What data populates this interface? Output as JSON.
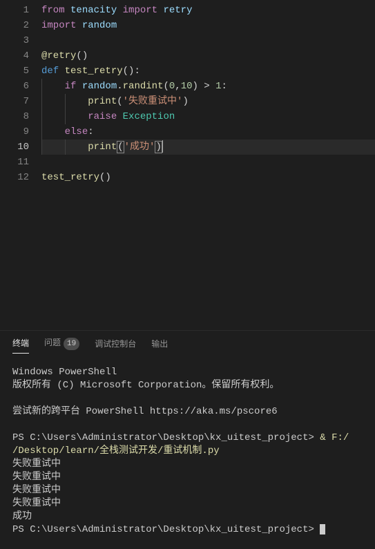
{
  "editor": {
    "current_line": 10,
    "lines": [
      {
        "n": 1,
        "tokens": [
          {
            "t": "from",
            "c": "keyword"
          },
          {
            "t": " "
          },
          {
            "t": "tenacity",
            "c": "ident"
          },
          {
            "t": " "
          },
          {
            "t": "import",
            "c": "keyword"
          },
          {
            "t": " "
          },
          {
            "t": "retry",
            "c": "ident"
          }
        ]
      },
      {
        "n": 2,
        "tokens": [
          {
            "t": "import",
            "c": "keyword"
          },
          {
            "t": " "
          },
          {
            "t": "random",
            "c": "ident"
          }
        ]
      },
      {
        "n": 3,
        "tokens": []
      },
      {
        "n": 4,
        "tokens": [
          {
            "t": "@retry",
            "c": "deco"
          },
          {
            "t": "()",
            "c": "punc"
          }
        ]
      },
      {
        "n": 5,
        "tokens": [
          {
            "t": "def",
            "c": "builtin"
          },
          {
            "t": " "
          },
          {
            "t": "test_retry",
            "c": "func"
          },
          {
            "t": "():",
            "c": "punc"
          }
        ]
      },
      {
        "n": 6,
        "indent": 1,
        "tokens": [
          {
            "t": "    "
          },
          {
            "t": "if",
            "c": "keyword"
          },
          {
            "t": " "
          },
          {
            "t": "random",
            "c": "ident"
          },
          {
            "t": ".",
            "c": "punc"
          },
          {
            "t": "randint",
            "c": "func"
          },
          {
            "t": "(",
            "c": "punc"
          },
          {
            "t": "0",
            "c": "num"
          },
          {
            "t": ",",
            "c": "punc"
          },
          {
            "t": "10",
            "c": "num"
          },
          {
            "t": ") > ",
            "c": "op"
          },
          {
            "t": "1",
            "c": "num"
          },
          {
            "t": ":",
            "c": "punc"
          }
        ]
      },
      {
        "n": 7,
        "indent": 2,
        "tokens": [
          {
            "t": "        "
          },
          {
            "t": "print",
            "c": "func"
          },
          {
            "t": "(",
            "c": "punc"
          },
          {
            "t": "'失败重试中'",
            "c": "string"
          },
          {
            "t": ")",
            "c": "punc"
          }
        ]
      },
      {
        "n": 8,
        "indent": 2,
        "tokens": [
          {
            "t": "        "
          },
          {
            "t": "raise",
            "c": "keyword"
          },
          {
            "t": " "
          },
          {
            "t": "Exception",
            "c": "type"
          }
        ]
      },
      {
        "n": 9,
        "indent": 1,
        "tokens": [
          {
            "t": "    "
          },
          {
            "t": "else",
            "c": "keyword"
          },
          {
            "t": ":",
            "c": "punc"
          }
        ]
      },
      {
        "n": 10,
        "indent": 2,
        "current": true,
        "tokens": [
          {
            "t": "        "
          },
          {
            "t": "print",
            "c": "func"
          },
          {
            "t": "(",
            "c": "punc",
            "box": true
          },
          {
            "t": "'成功'",
            "c": "string"
          },
          {
            "t": ")",
            "c": "punc",
            "box": true
          }
        ]
      },
      {
        "n": 11,
        "tokens": []
      },
      {
        "n": 12,
        "tokens": [
          {
            "t": "test_retry",
            "c": "func"
          },
          {
            "t": "()",
            "c": "punc"
          }
        ]
      }
    ]
  },
  "panel": {
    "tabs": [
      {
        "id": "terminal",
        "label": "终端",
        "active": true
      },
      {
        "id": "problems",
        "label": "问题",
        "badge": "19"
      },
      {
        "id": "debug",
        "label": "调试控制台"
      },
      {
        "id": "output",
        "label": "输出"
      }
    ]
  },
  "terminal": {
    "lines": [
      {
        "t": "Windows PowerShell"
      },
      {
        "t": "版权所有 (C) Microsoft Corporation。保留所有权利。"
      },
      {
        "t": ""
      },
      {
        "t": "尝试新的跨平台 PowerShell https://aka.ms/pscore6"
      },
      {
        "t": ""
      },
      {
        "spans": [
          {
            "t": "PS C:\\Users\\Administrator\\Desktop\\kx_uitest_project> "
          },
          {
            "t": "& ",
            "c": "yellow"
          },
          {
            "t": "F:/",
            "c": "yellow"
          }
        ]
      },
      {
        "spans": [
          {
            "t": "/Desktop/learn/全栈测试开发/重试机制.py",
            "c": "yellow"
          }
        ]
      },
      {
        "t": "失败重试中"
      },
      {
        "t": "失败重试中"
      },
      {
        "t": "失败重试中"
      },
      {
        "t": "失败重试中"
      },
      {
        "t": "成功"
      },
      {
        "spans": [
          {
            "t": "PS C:\\Users\\Administrator\\Desktop\\kx_uitest_project> "
          },
          {
            "cursor": true
          }
        ]
      }
    ]
  }
}
